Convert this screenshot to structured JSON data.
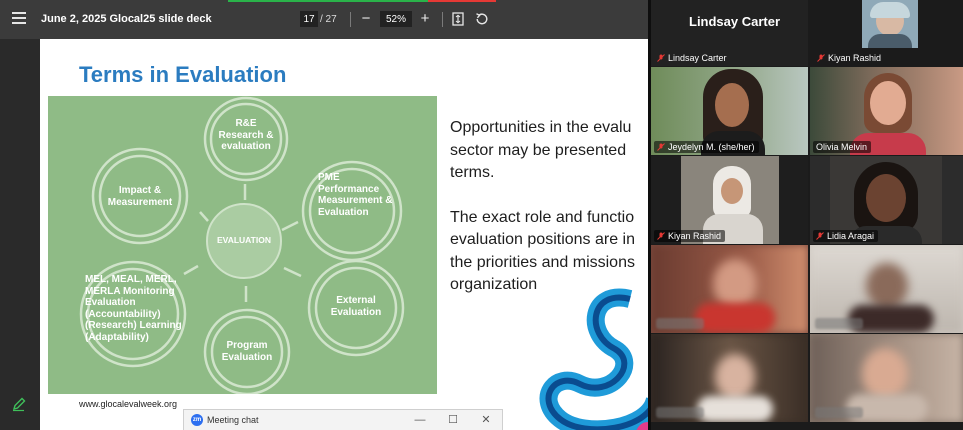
{
  "viewer": {
    "doc_title": "June 2, 2025 Glocal25 slide deck",
    "page_current": "17",
    "page_total": "/ 27",
    "zoom_value": "52%",
    "zoom_out": "−",
    "zoom_in": "+"
  },
  "slide": {
    "title": "Terms in Evaluation",
    "diagram": {
      "center": "EVALUATION",
      "nodes": [
        {
          "label": "R&E Research & evaluation"
        },
        {
          "label": "PME Performance Measurement & Evaluation"
        },
        {
          "label": "External Evaluation"
        },
        {
          "label": "Program Evaluation"
        },
        {
          "label": "MEL, MEAL, MERL, MERLA Monitoring Evaluation (Accountability) (Research) Learning (Adaptability)"
        },
        {
          "label": "Impact & Measurement"
        }
      ]
    },
    "body_lines_1": [
      "Opportunities in the evalu",
      "sector may be presented",
      "terms."
    ],
    "body_lines_2": [
      "The exact role and functio",
      "evaluation positions are in",
      "the priorities and missions",
      "organization"
    ],
    "footer_url": "www.glocalevalweek.org"
  },
  "chat": {
    "title": "Meeting chat",
    "icon_text": "zm"
  },
  "gallery": {
    "active_speaker": "Lindsay Carter",
    "tiles": [
      {
        "name": "Lindsay Carter"
      },
      {
        "name": "Kiyan Rashid"
      },
      {
        "name": "Jeydelyn M. (she/her)"
      },
      {
        "name": "Olivia Melvin"
      },
      {
        "name": "Kiyan Rashid"
      },
      {
        "name": "Lidia Aragai"
      }
    ]
  },
  "colors": {
    "title_blue": "#2b7cc0",
    "diagram_green": "#8fbb86",
    "active_outline": "#30c56a",
    "mute_red": "#e53935"
  }
}
